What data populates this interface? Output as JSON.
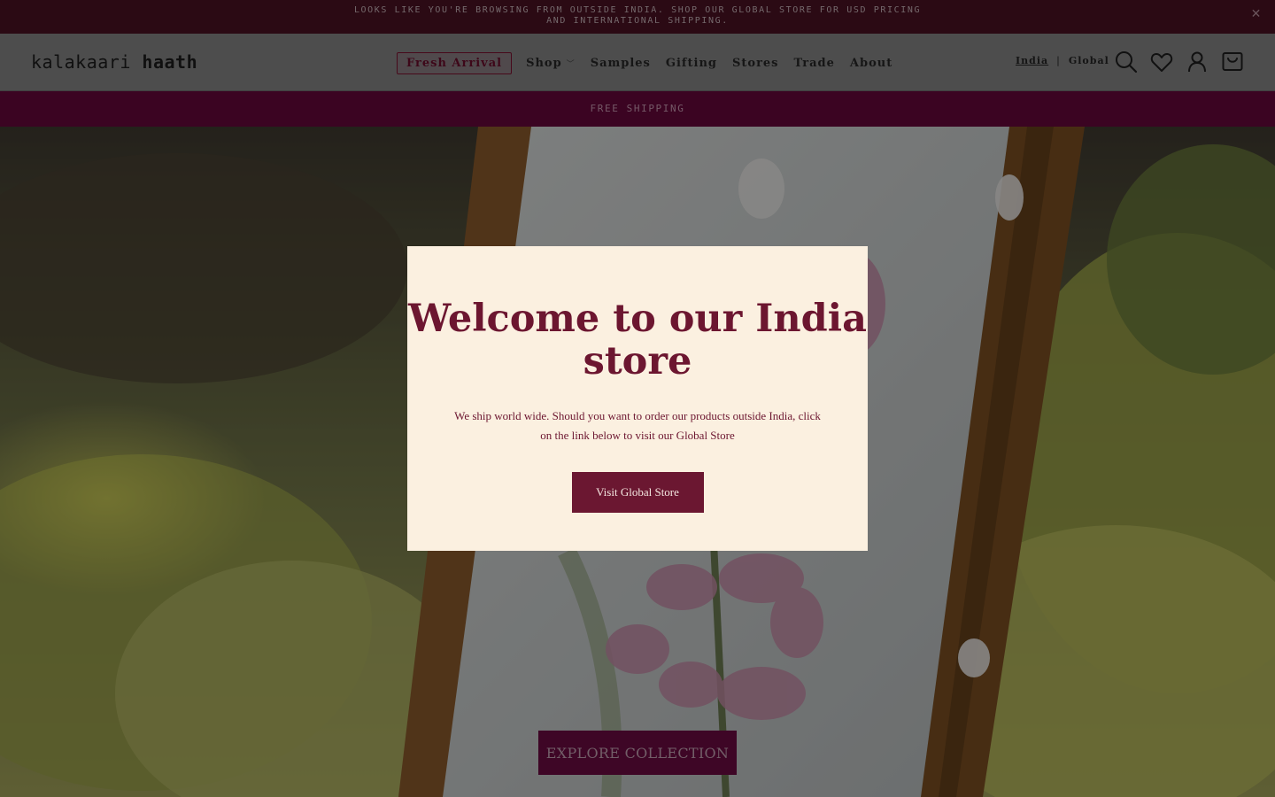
{
  "announcement": {
    "text": "LOOKS LIKE YOU'RE BROWSING FROM OUTSIDE INDIA. SHOP OUR GLOBAL STORE FOR USD PRICING AND INTERNATIONAL SHIPPING.",
    "close_icon": "close-icon"
  },
  "header": {
    "logo_light": "kalakaari",
    "logo_bold": "haath",
    "nav": {
      "fresh": "Fresh Arrival",
      "shop": "Shop",
      "samples": "Samples",
      "gifting": "Gifting",
      "stores": "Stores",
      "trade": "Trade",
      "about": "About"
    },
    "region": {
      "india": "India",
      "separator": "|",
      "global": "Global"
    },
    "icons": [
      "search-icon",
      "heart-icon",
      "user-icon",
      "cart-icon"
    ]
  },
  "shipping_bar": {
    "text": "FREE SHIPPING"
  },
  "hero": {
    "cta": "EXPLORE COLLECTION"
  },
  "modal": {
    "title": "Welcome to our India store",
    "body": "We ship world wide. Should you want to order our products outside India, click on the link below to visit our Global Store",
    "button": "Visit Global Store"
  },
  "colors": {
    "announce_bg": "#4a1224",
    "header_bg": "#868686",
    "shipping_bg": "#66073b",
    "modal_bg": "#fbf0e0",
    "brand": "#6c1630"
  }
}
